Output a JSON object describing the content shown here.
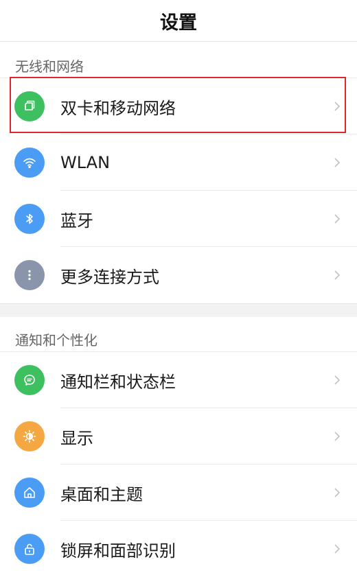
{
  "header": {
    "title": "设置"
  },
  "sections": [
    {
      "title": "无线和网络",
      "items": [
        {
          "label": "双卡和移动网络",
          "icon": "dual-sim-icon",
          "color": "#3ebf60"
        },
        {
          "label": "WLAN",
          "icon": "wifi-icon",
          "color": "#4a9cf5"
        },
        {
          "label": "蓝牙",
          "icon": "bluetooth-icon",
          "color": "#4a9cf5"
        },
        {
          "label": "更多连接方式",
          "icon": "more-dots-icon",
          "color": "#8a94ab"
        }
      ]
    },
    {
      "title": "通知和个性化",
      "items": [
        {
          "label": "通知栏和状态栏",
          "icon": "message-icon",
          "color": "#3ebf60"
        },
        {
          "label": "显示",
          "icon": "brightness-icon",
          "color": "#f5a742"
        },
        {
          "label": "桌面和主题",
          "icon": "home-icon",
          "color": "#4a9cf5"
        },
        {
          "label": "锁屏和面部识别",
          "icon": "lock-icon",
          "color": "#4a9cf5"
        }
      ]
    }
  ],
  "highlight_color": "#e0252b"
}
